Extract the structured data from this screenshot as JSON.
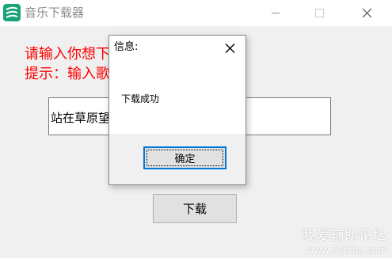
{
  "window": {
    "title": "音乐下载器",
    "icon": "music-download-app-icon"
  },
  "titlebar_buttons": [
    "minimize-icon",
    "maximize-icon",
    "close-icon"
  ],
  "main": {
    "prompt_line1": "请输入你想下载的歌曲",
    "prompt_line2": "提示：输入歌曲名",
    "search_value": "站在草原望北京",
    "download_label": "下载"
  },
  "dialog": {
    "title": "信息:",
    "message": "下载成功",
    "ok_label": "确定"
  },
  "watermark": {
    "line1": "我爱辅助论坛",
    "line2": "www.52fzba.com"
  },
  "colors": {
    "prompt": "#ff0000",
    "focus_border": "#0078d7",
    "app_icon": "#1aa37a"
  }
}
